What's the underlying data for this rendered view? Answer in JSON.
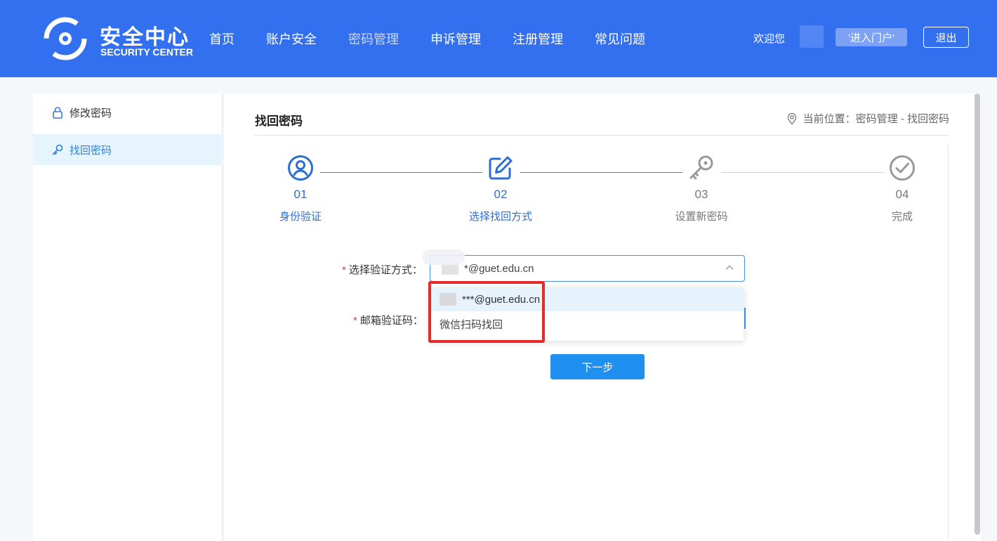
{
  "header": {
    "logo_title": "安全中心",
    "logo_subtitle": "SECURITY CENTER",
    "nav": [
      {
        "label": "首页"
      },
      {
        "label": "账户安全"
      },
      {
        "label": "密码管理"
      },
      {
        "label": "申诉管理"
      },
      {
        "label": "注册管理"
      },
      {
        "label": "常见问题"
      }
    ],
    "welcome": "欢迎您",
    "portal_button": "'进入门户'",
    "logout_button": "退出",
    "bg_color": "#3370f0"
  },
  "sidebar": {
    "items": [
      {
        "label": "修改密码",
        "icon": "lock-icon"
      },
      {
        "label": "找回密码",
        "icon": "key-icon",
        "active": true
      }
    ]
  },
  "main": {
    "title": "找回密码",
    "breadcrumb": "当前位置：密码管理 - 找回密码",
    "steps": [
      {
        "num": "01",
        "label": "身份验证",
        "icon": "user-circle-icon",
        "state": "done"
      },
      {
        "num": "02",
        "label": "选择找回方式",
        "icon": "edit-icon",
        "state": "current"
      },
      {
        "num": "03",
        "label": "设置新密码",
        "icon": "key-icon",
        "state": "pending"
      },
      {
        "num": "04",
        "label": "完成",
        "icon": "check-circle-icon",
        "state": "pending"
      }
    ],
    "form": {
      "method_label": "选择验证方式：",
      "method_value": "*@guet.edu.cn",
      "code_label": "邮箱验证码：",
      "options": [
        {
          "label": "***@guet.edu.cn"
        },
        {
          "label": "微信扫码找回"
        }
      ],
      "next_button": "下一步"
    }
  },
  "colors": {
    "accent": "#2b6dd6",
    "highlight": "#e62a2a",
    "button": "#1f8ff0"
  }
}
